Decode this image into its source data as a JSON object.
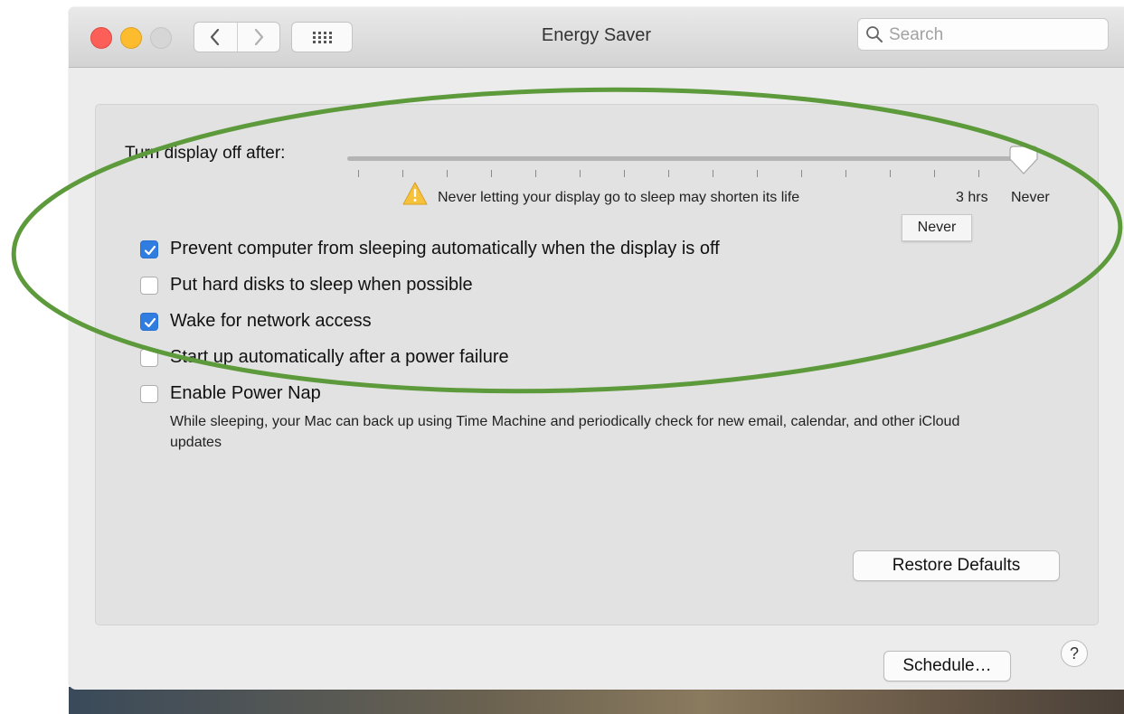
{
  "window": {
    "title": "Energy Saver"
  },
  "search": {
    "placeholder": "Search"
  },
  "display_sleep": {
    "label": "Turn display off after:",
    "value": "Never",
    "warning": "Never letting your display go to sleep may shorten its life",
    "tick_labels": [
      "3 hrs",
      "Never"
    ],
    "tooltip": "Never"
  },
  "options": [
    {
      "label": "Prevent computer from sleeping automatically when the display is off",
      "checked": true
    },
    {
      "label": "Put hard disks to sleep when possible",
      "checked": false
    },
    {
      "label": "Wake for network access",
      "checked": true
    },
    {
      "label": "Start up automatically after a power failure",
      "checked": false
    },
    {
      "label": "Enable Power Nap",
      "checked": false
    }
  ],
  "power_nap_description": "While sleeping, your Mac can back up using Time Machine and periodically check for new email, calendar, and other iCloud updates",
  "buttons": {
    "restore_defaults": "Restore Defaults",
    "schedule": "Schedule…",
    "help": "?"
  },
  "colors": {
    "accent": "#2f7de1",
    "annotation": "#5d9a3c"
  },
  "icons": [
    "back-chevron-icon",
    "forward-chevron-icon",
    "grid-icon",
    "search-icon",
    "warning-icon",
    "checkmark-icon"
  ]
}
